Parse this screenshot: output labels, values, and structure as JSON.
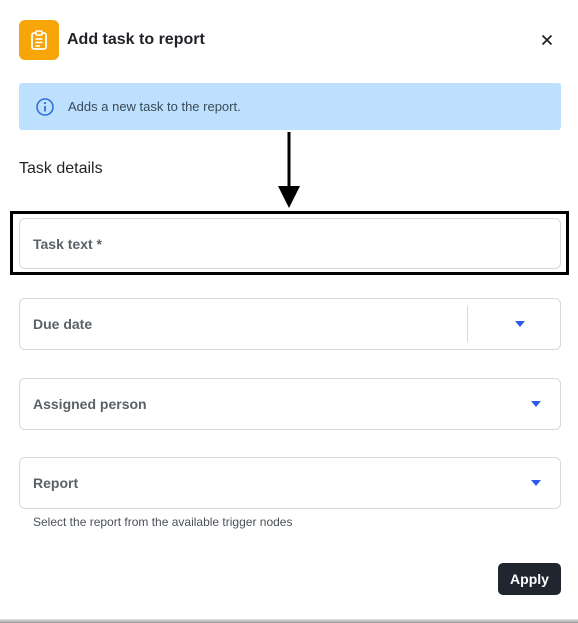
{
  "dialog": {
    "title": "Add task to report",
    "app_icon": "clipboard-icon",
    "close_icon": "close-icon"
  },
  "info_banner": {
    "icon": "info-icon",
    "text": "Adds a new task to the report."
  },
  "section_title": "Task details",
  "fields": {
    "task_text": {
      "label": "Task text *"
    },
    "due_date": {
      "label": "Due date",
      "icon": "chevron-down-icon"
    },
    "assigned_person": {
      "label": "Assigned person",
      "icon": "chevron-down-icon"
    },
    "report": {
      "label": "Report",
      "icon": "chevron-down-icon",
      "helper": "Select the report from the available trigger nodes"
    }
  },
  "actions": {
    "apply_label": "Apply"
  },
  "colors": {
    "accent_orange": "#f6a609",
    "banner_blue": "#bde0fe",
    "chevron_blue": "#2f5bea",
    "apply_bg": "#1f2630"
  }
}
